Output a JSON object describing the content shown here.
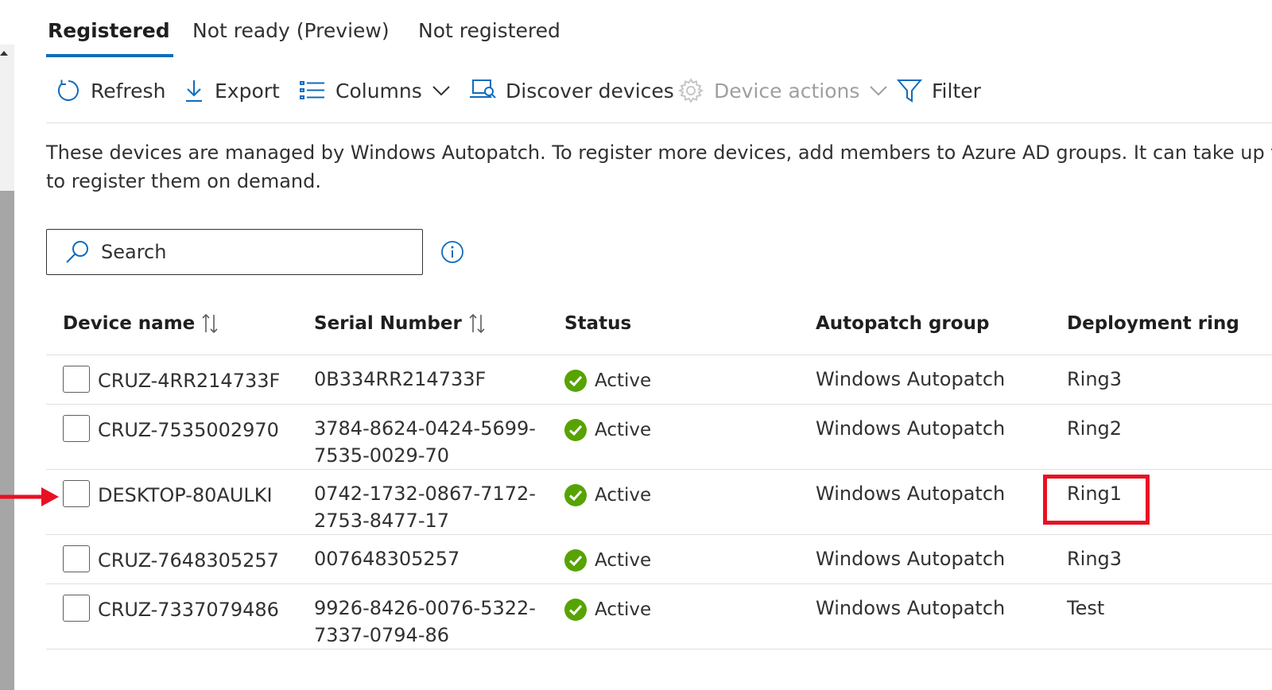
{
  "tabs": [
    {
      "label": "Registered",
      "active": true
    },
    {
      "label": "Not ready (Preview)",
      "active": false
    },
    {
      "label": "Not registered",
      "active": false
    }
  ],
  "toolbar": {
    "refresh": {
      "label": "Refresh",
      "icon": "refresh-icon"
    },
    "export": {
      "label": "Export",
      "icon": "download-icon"
    },
    "columns": {
      "label": "Columns",
      "icon": "list-icon"
    },
    "discover": {
      "label": "Discover devices",
      "icon": "discover-devices-icon"
    },
    "device_actions": {
      "label": "Device actions",
      "icon": "gear-icon",
      "disabled": true
    },
    "filter": {
      "label": "Filter",
      "icon": "filter-icon"
    }
  },
  "description": {
    "line1": "These devices are managed by Windows Autopatch. To register more devices, add members to Azure AD groups. It can take up to an",
    "line2": "to register them on demand."
  },
  "search": {
    "placeholder": "Search"
  },
  "table": {
    "headers": {
      "device_name": "Device name",
      "serial_number": "Serial Number",
      "status": "Status",
      "autopatch_group": "Autopatch group",
      "deployment_ring": "Deployment ring"
    },
    "rows": [
      {
        "device": "CRUZ-4RR214733F",
        "serial_1": "0B334RR214733F",
        "serial_2": "",
        "status": "Active",
        "group": "Windows Autopatch",
        "ring": "Ring3"
      },
      {
        "device": "CRUZ-7535002970",
        "serial_1": "3784-8624-0424-5699-",
        "serial_2": "7535-0029-70",
        "status": "Active",
        "group": "Windows Autopatch",
        "ring": "Ring2"
      },
      {
        "device": "DESKTOP-80AULKI",
        "serial_1": "0742-1732-0867-7172-",
        "serial_2": "2753-8477-17",
        "status": "Active",
        "group": "Windows Autopatch",
        "ring": "Ring1"
      },
      {
        "device": "CRUZ-7648305257",
        "serial_1": "007648305257",
        "serial_2": "",
        "status": "Active",
        "group": "Windows Autopatch",
        "ring": "Ring3"
      },
      {
        "device": "CRUZ-7337079486",
        "serial_1": "9926-8426-0076-5322-",
        "serial_2": "7337-0794-86",
        "status": "Active",
        "group": "Windows Autopatch",
        "ring": "Test"
      }
    ]
  },
  "colors": {
    "accent": "#0f6cbd",
    "status_active": "#57a300",
    "annotation_red": "#e81123"
  }
}
